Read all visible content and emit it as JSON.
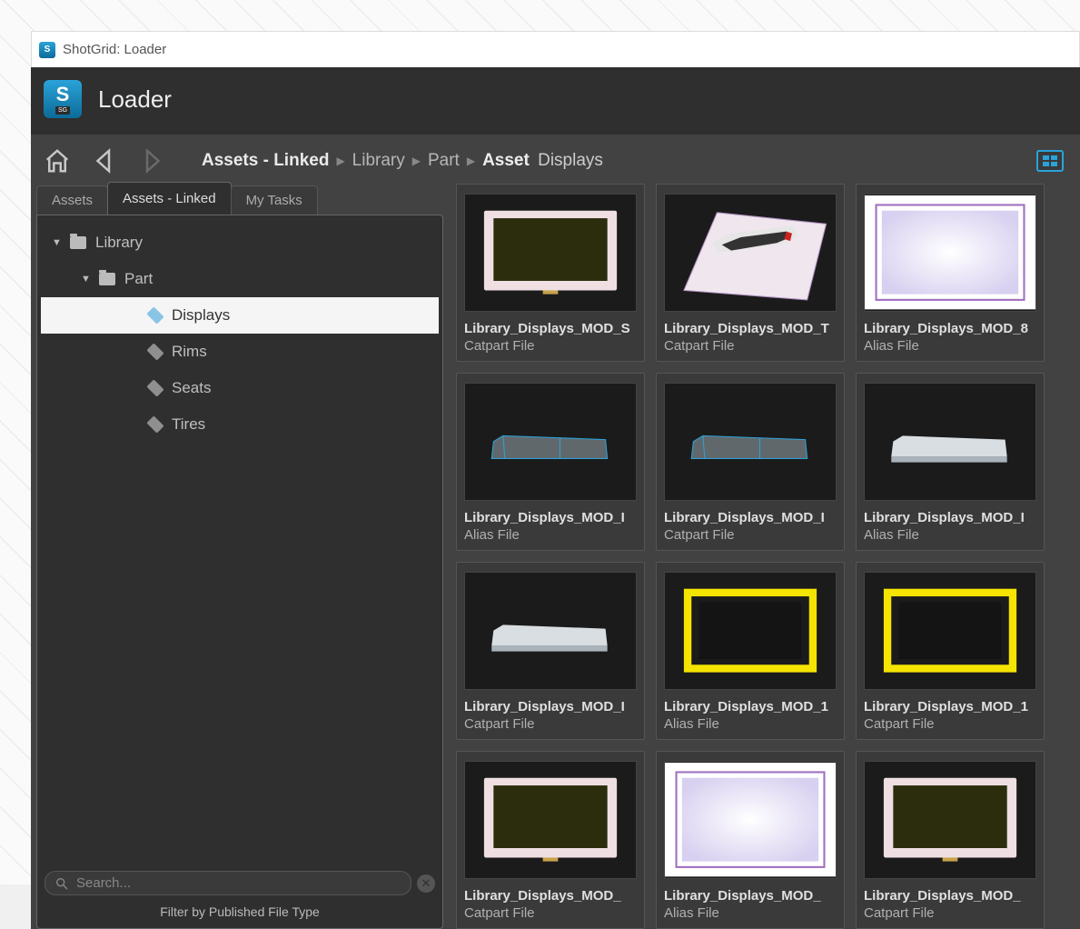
{
  "os_title": "ShotGrid: Loader",
  "app_title": "Loader",
  "breadcrumb": {
    "root": "Assets - Linked",
    "items": [
      "Library",
      "Part"
    ],
    "current_prefix": "Asset",
    "current_name": "Displays"
  },
  "tabs": [
    {
      "label": "Assets",
      "active": false
    },
    {
      "label": "Assets - Linked",
      "active": true
    },
    {
      "label": "My Tasks",
      "active": false
    }
  ],
  "tree": [
    {
      "level": 0,
      "label": "Library",
      "icon": "folder",
      "expanded": true
    },
    {
      "level": 1,
      "label": "Part",
      "icon": "folder",
      "expanded": true
    },
    {
      "level": 2,
      "label": "Displays",
      "icon": "box",
      "selected": true
    },
    {
      "level": 2,
      "label": "Rims",
      "icon": "box"
    },
    {
      "level": 2,
      "label": "Seats",
      "icon": "box"
    },
    {
      "level": 2,
      "label": "Tires",
      "icon": "box"
    }
  ],
  "search": {
    "placeholder": "Search..."
  },
  "filter_hint": "Filter by Published File Type",
  "assets": [
    {
      "title": "Library_Displays_MOD_S",
      "sub": "Catpart File",
      "thumb": "screen-dark"
    },
    {
      "title": "Library_Displays_MOD_T",
      "sub": "Catpart File",
      "thumb": "device"
    },
    {
      "title": "Library_Displays_MOD_8",
      "sub": "Alias File",
      "thumb": "screen-light"
    },
    {
      "title": "Library_Displays_MOD_I",
      "sub": "Alias File",
      "thumb": "bar-wire"
    },
    {
      "title": "Library_Displays_MOD_I",
      "sub": "Catpart File",
      "thumb": "bar-wire"
    },
    {
      "title": "Library_Displays_MOD_I",
      "sub": "Alias File",
      "thumb": "bar-solid"
    },
    {
      "title": "Library_Displays_MOD_I",
      "sub": "Catpart File",
      "thumb": "bar-solid"
    },
    {
      "title": "Library_Displays_MOD_1",
      "sub": "Alias File",
      "thumb": "yellow-frame"
    },
    {
      "title": "Library_Displays_MOD_1",
      "sub": "Catpart File",
      "thumb": "yellow-frame"
    },
    {
      "title": "Library_Displays_MOD_",
      "sub": "Catpart File",
      "thumb": "screen-dark"
    },
    {
      "title": "Library_Displays_MOD_",
      "sub": "Alias File",
      "thumb": "screen-light"
    },
    {
      "title": "Library_Displays_MOD_",
      "sub": "Catpart File",
      "thumb": "screen-dark"
    }
  ]
}
